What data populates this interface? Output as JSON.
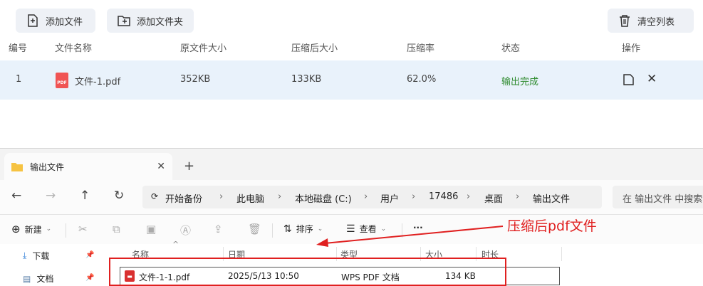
{
  "toolbar": {
    "add_file": "添加文件",
    "add_folder": "添加文件夹",
    "clear_list": "清空列表"
  },
  "table": {
    "headers": [
      "编号",
      "文件名称",
      "原文件大小",
      "压缩后大小",
      "压缩率",
      "状态",
      "操作"
    ],
    "row": {
      "index": "1",
      "file_icon_text": "PDF",
      "name": "文件-1.pdf",
      "original_size": "352KB",
      "compressed_size": "133KB",
      "ratio": "62.0%",
      "status": "输出完成"
    },
    "status_color": "#2e8b2e"
  },
  "explorer": {
    "tab_title": "输出文件",
    "breadcrumb": [
      "开始备份",
      "此电脑",
      "本地磁盘 (C:)",
      "用户",
      "17486",
      "桌面",
      "输出文件"
    ],
    "search_placeholder": "在 输出文件 中搜索",
    "cmd": {
      "new": "新建",
      "sort": "排序",
      "view": "查看",
      "more": "···"
    },
    "sidebar": [
      {
        "label": "下载"
      },
      {
        "label": "文档"
      }
    ],
    "columns": [
      "名称",
      "日期",
      "类型",
      "大小",
      "时长"
    ],
    "file": {
      "name": "文件-1-1.pdf",
      "date": "2025/5/13 10:50",
      "type": "WPS PDF 文档",
      "size": "134 KB"
    }
  },
  "annotation": {
    "text": "压缩后pdf文件",
    "color": "#e02020"
  }
}
